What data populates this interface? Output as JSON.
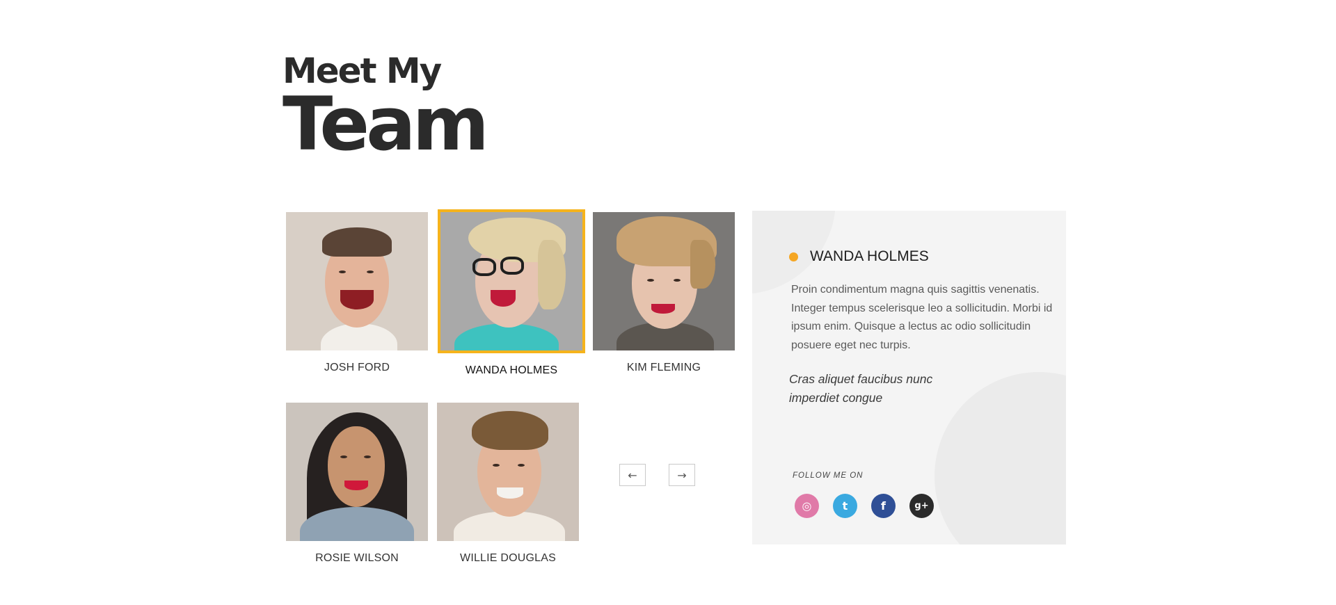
{
  "heading": {
    "line1": "Meet My",
    "line2": "Team"
  },
  "members": [
    {
      "name": "JOSH FORD",
      "selected": false
    },
    {
      "name": "WANDA HOLMES",
      "selected": true
    },
    {
      "name": "KIM FLEMING",
      "selected": false
    },
    {
      "name": "ROSIE WILSON",
      "selected": false
    },
    {
      "name": "WILLIE DOUGLAS",
      "selected": false
    }
  ],
  "nav": {
    "prev": "←",
    "next": "→"
  },
  "detail": {
    "name": "WANDA HOLMES",
    "description": "Proin condimentum magna quis sagittis venenatis. Integer tempus scelerisque leo a sollicitudin. Morbi id ipsum enim. Quisque a lectus ac odio sollicitudin posuere eget nec turpis.",
    "quote": "Cras aliquet faucibus nunc imperdiet congue",
    "follow_label": "FOLLOW ME ON",
    "socials": [
      {
        "icon": "dribbble-icon",
        "glyph": "◎",
        "color": "#e07aa8"
      },
      {
        "icon": "twitter-icon",
        "glyph": "t",
        "color": "#3aa9e0"
      },
      {
        "icon": "facebook-icon",
        "glyph": "f",
        "color": "#2f4f96"
      },
      {
        "icon": "google-plus-icon",
        "glyph": "g+",
        "color": "#2b2b2b"
      }
    ]
  },
  "colors": {
    "accent": "#f5b31c",
    "dot": "#f5a623"
  }
}
